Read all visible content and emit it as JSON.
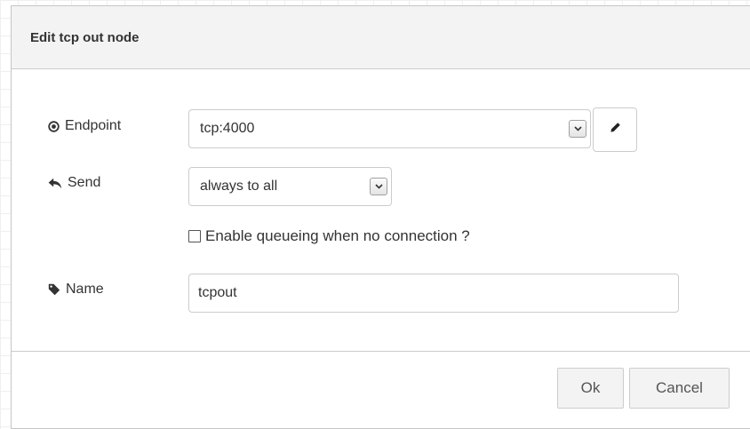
{
  "dialog": {
    "title": "Edit tcp out node"
  },
  "form": {
    "endpoint": {
      "label": "Endpoint",
      "icon": "dot-circle-icon",
      "value": "tcp:4000",
      "edit_icon": "pencil-icon"
    },
    "send": {
      "label": "Send",
      "icon": "reply-arrow-icon",
      "value": "always to all"
    },
    "queue": {
      "label": "Enable queueing when no connection ?",
      "checked": false
    },
    "name": {
      "label": "Name",
      "icon": "tag-icon",
      "value": "tcpout"
    }
  },
  "buttons": {
    "ok": "Ok",
    "cancel": "Cancel"
  }
}
